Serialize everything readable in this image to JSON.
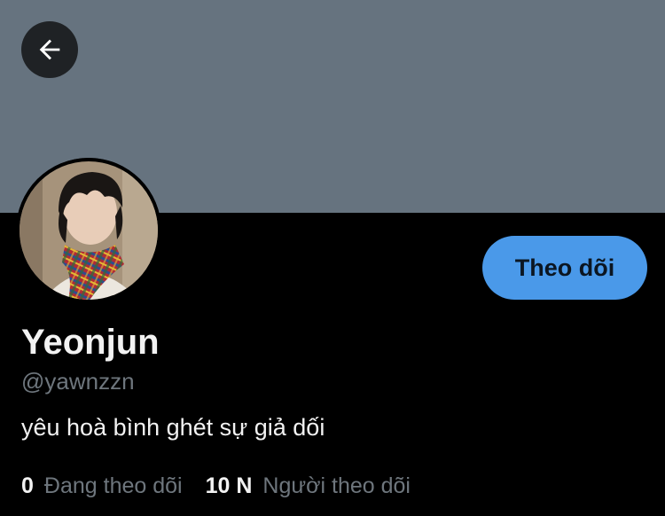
{
  "header": {
    "back_icon": "arrow-left-icon",
    "banner_color": "#66737f"
  },
  "profile": {
    "avatar_icon": "profile-photo",
    "display_name": "Yeonjun",
    "handle": "@yawnzzn",
    "bio": "yêu hoà bình ghét sự giả dối",
    "follow_label": "Theo dõi",
    "accent_color": "#4a99e9"
  },
  "stats": {
    "following_count": "0",
    "following_label": "Đang theo dõi",
    "followers_count": "10 N",
    "followers_label": "Người theo dõi"
  }
}
